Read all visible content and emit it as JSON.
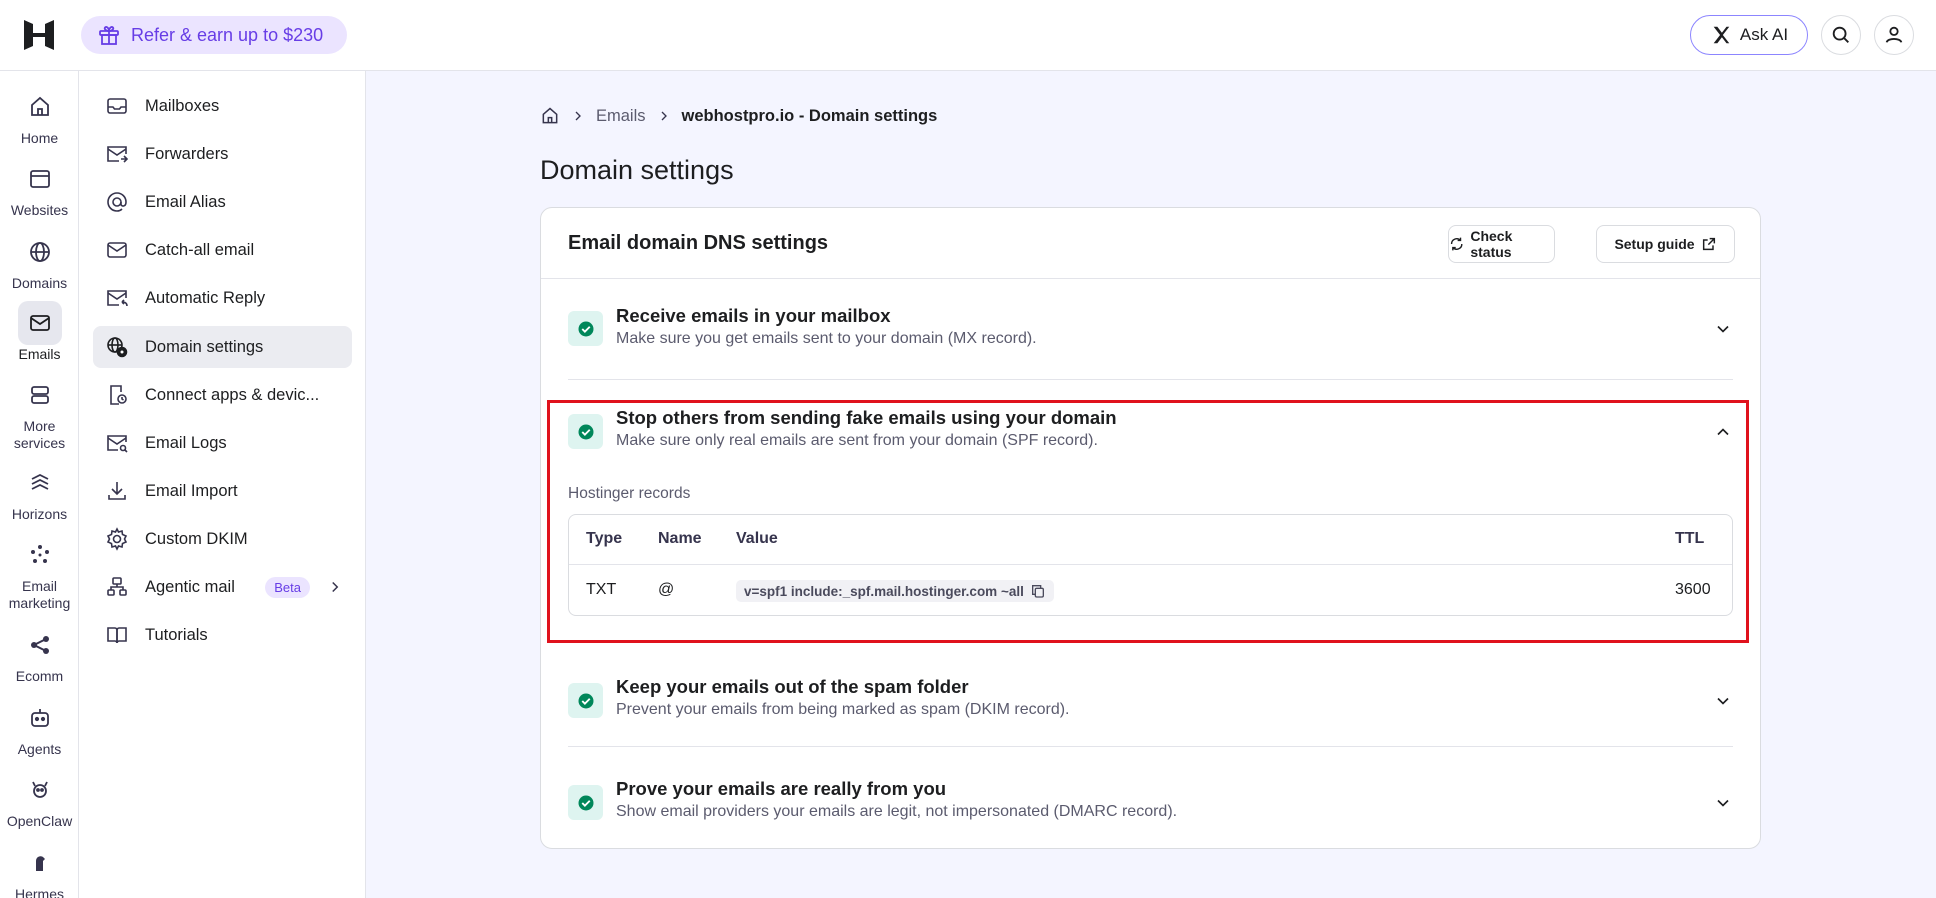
{
  "topbar": {
    "refer_label": "Refer & earn up to $230",
    "ask_ai_label": "Ask AI",
    "search_icon": "search-icon",
    "account_icon": "user-icon"
  },
  "rail": [
    {
      "label": "Home",
      "icon": "home-icon"
    },
    {
      "label": "Websites",
      "icon": "browser-icon"
    },
    {
      "label": "Domains",
      "icon": "globe-icon"
    },
    {
      "label": "Emails",
      "icon": "mail-icon",
      "active": true
    },
    {
      "label": "More services",
      "icon": "server-icon"
    },
    {
      "label": "Horizons",
      "icon": "horizons-icon"
    },
    {
      "label": "Email marketing",
      "icon": "sparkle-icon"
    },
    {
      "label": "Ecomm",
      "icon": "share-icon"
    },
    {
      "label": "Agents",
      "icon": "robot-icon"
    },
    {
      "label": "OpenClaw",
      "icon": "claw-icon"
    },
    {
      "label": "Hermes",
      "icon": "hermes-icon"
    }
  ],
  "submenu": [
    {
      "label": "Mailboxes"
    },
    {
      "label": "Forwarders"
    },
    {
      "label": "Email Alias"
    },
    {
      "label": "Catch-all email"
    },
    {
      "label": "Automatic Reply"
    },
    {
      "label": "Domain settings",
      "active": true
    },
    {
      "label": "Connect apps & devic..."
    },
    {
      "label": "Email Logs"
    },
    {
      "label": "Email Import"
    },
    {
      "label": "Custom DKIM"
    },
    {
      "label": "Agentic mail",
      "badge": "Beta"
    },
    {
      "label": "Tutorials"
    }
  ],
  "breadcrumb": {
    "emails": "Emails",
    "current": "webhostpro.io - Domain settings"
  },
  "page_title": "Domain settings",
  "card": {
    "title": "Email domain DNS settings",
    "check_status_label": "Check status",
    "setup_guide_label": "Setup guide"
  },
  "sections": [
    {
      "title": "Receive emails in your mailbox",
      "desc": "Make sure you get emails sent to your domain (MX record)."
    },
    {
      "title": "Stop others from sending fake emails using your domain",
      "desc": "Make sure only real emails are sent from your domain (SPF record)."
    },
    {
      "title": "Keep your emails out of the spam folder",
      "desc": "Prevent your emails from being marked as spam (DKIM record)."
    },
    {
      "title": "Prove your emails are really from you",
      "desc": "Show email providers your emails are legit, not impersonated (DMARC record)."
    }
  ],
  "records": {
    "label": "Hostinger records",
    "headers": {
      "type": "Type",
      "name": "Name",
      "value": "Value",
      "ttl": "TTL"
    },
    "row": {
      "type": "TXT",
      "name": "@",
      "value": "v=spf1 include:_spf.mail.hostinger.com ~all",
      "ttl": "3600"
    }
  },
  "colors": {
    "accent": "#673de6",
    "success": "#00b090",
    "highlight": "#e0121d"
  }
}
